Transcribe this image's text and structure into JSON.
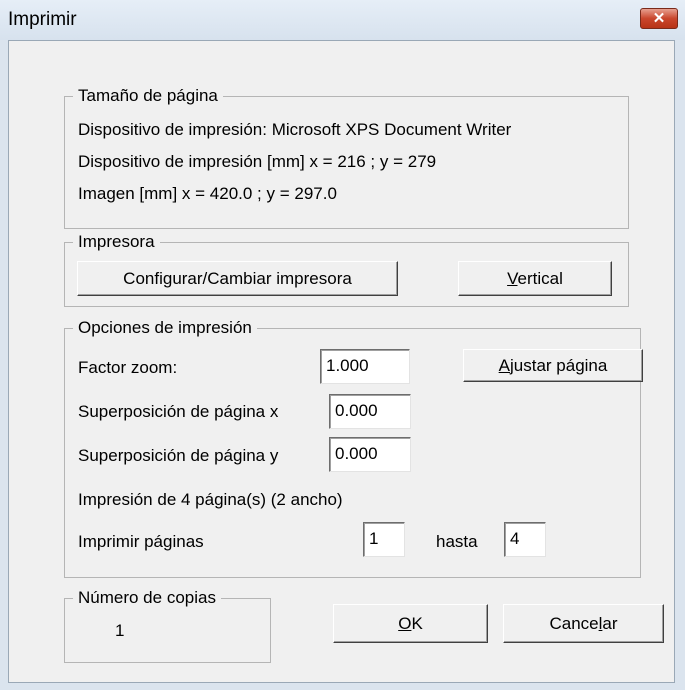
{
  "window": {
    "title": "Imprimir",
    "close_glyph": "✕"
  },
  "page_size": {
    "legend": "Tamaño de página",
    "device_line": "Dispositivo de impresión: Microsoft XPS Document Writer",
    "device_mm_line": "Dispositivo de impresión [mm]  x = 216 ; y = 279",
    "image_mm_line": "Imagen [mm] x = 420.0 ; y = 297.0"
  },
  "printer": {
    "legend": "Impresora",
    "configure_button": "Configurar/Cambiar impresora",
    "orientation_button": {
      "accel": "V",
      "rest": "ertical"
    }
  },
  "print_options": {
    "legend": "Opciones de impresión",
    "zoom_label": "Factor zoom:",
    "zoom_value": "1.000",
    "fit_page_button": {
      "accel": "A",
      "rest": "justar página"
    },
    "overlap_x_label": "Superposición de página x",
    "overlap_x_value": "0.000",
    "overlap_y_label": "Superposición de página y",
    "overlap_y_value": "0.000",
    "pages_info": "Impresión de 4 página(s) (2 ancho)",
    "print_pages_label": "Imprimir páginas",
    "from_value": "1",
    "to_label": "hasta",
    "to_value": "4"
  },
  "copies": {
    "legend": "Número de copias",
    "value": "1"
  },
  "buttons": {
    "ok": {
      "accel": "O",
      "rest": "K"
    },
    "cancel": {
      "pre": "Cance",
      "accel": "l",
      "rest": "ar"
    }
  }
}
